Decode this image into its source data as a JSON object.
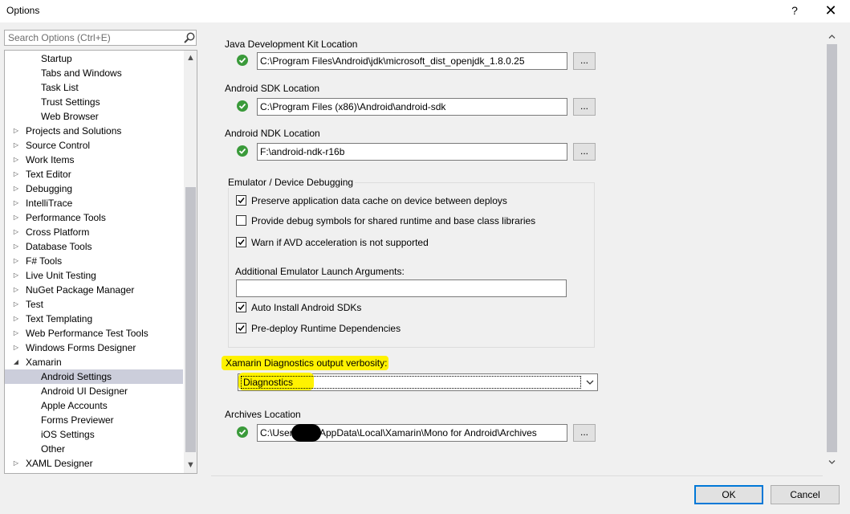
{
  "window": {
    "title": "Options",
    "help_glyph": "?",
    "close_glyph": "✕"
  },
  "search": {
    "placeholder": "Search Options (Ctrl+E)"
  },
  "tree": {
    "items": [
      {
        "label": "Startup",
        "level": 1,
        "expandable": false
      },
      {
        "label": "Tabs and Windows",
        "level": 1,
        "expandable": false
      },
      {
        "label": "Task List",
        "level": 1,
        "expandable": false
      },
      {
        "label": "Trust Settings",
        "level": 1,
        "expandable": false
      },
      {
        "label": "Web Browser",
        "level": 1,
        "expandable": false
      },
      {
        "label": "Projects and Solutions",
        "level": 0,
        "expandable": true
      },
      {
        "label": "Source Control",
        "level": 0,
        "expandable": true
      },
      {
        "label": "Work Items",
        "level": 0,
        "expandable": true
      },
      {
        "label": "Text Editor",
        "level": 0,
        "expandable": true
      },
      {
        "label": "Debugging",
        "level": 0,
        "expandable": true
      },
      {
        "label": "IntelliTrace",
        "level": 0,
        "expandable": true
      },
      {
        "label": "Performance Tools",
        "level": 0,
        "expandable": true
      },
      {
        "label": "Cross Platform",
        "level": 0,
        "expandable": true
      },
      {
        "label": "Database Tools",
        "level": 0,
        "expandable": true
      },
      {
        "label": "F# Tools",
        "level": 0,
        "expandable": true
      },
      {
        "label": "Live Unit Testing",
        "level": 0,
        "expandable": true
      },
      {
        "label": "NuGet Package Manager",
        "level": 0,
        "expandable": true
      },
      {
        "label": "Test",
        "level": 0,
        "expandable": true
      },
      {
        "label": "Text Templating",
        "level": 0,
        "expandable": true
      },
      {
        "label": "Web Performance Test Tools",
        "level": 0,
        "expandable": true
      },
      {
        "label": "Windows Forms Designer",
        "level": 0,
        "expandable": true
      },
      {
        "label": "Xamarin",
        "level": 0,
        "expandable": true,
        "expanded": true
      },
      {
        "label": "Android Settings",
        "level": 1,
        "expandable": false,
        "selected": true
      },
      {
        "label": "Android UI Designer",
        "level": 1,
        "expandable": false
      },
      {
        "label": "Apple Accounts",
        "level": 1,
        "expandable": false
      },
      {
        "label": "Forms Previewer",
        "level": 1,
        "expandable": false
      },
      {
        "label": "iOS Settings",
        "level": 1,
        "expandable": false
      },
      {
        "label": "Other",
        "level": 1,
        "expandable": false
      },
      {
        "label": "XAML Designer",
        "level": 0,
        "expandable": true
      }
    ]
  },
  "settings": {
    "jdk": {
      "label": "Java Development Kit Location",
      "value": "C:\\Program Files\\Android\\jdk\\microsoft_dist_openjdk_1.8.0.25",
      "browse": "..."
    },
    "sdk": {
      "label": "Android SDK Location",
      "value": "C:\\Program Files (x86)\\Android\\android-sdk",
      "browse": "..."
    },
    "ndk": {
      "label": "Android NDK Location",
      "value": "F:\\android-ndk-r16b",
      "browse": "..."
    },
    "emulator": {
      "title": "Emulator / Device Debugging",
      "preserve_cache": {
        "label": "Preserve application data cache on device between deploys",
        "checked": true
      },
      "debug_symbols": {
        "label": "Provide debug symbols for shared runtime and base class libraries",
        "checked": false
      },
      "warn_avd": {
        "label": "Warn if AVD acceleration is not supported",
        "checked": true
      },
      "args_label": "Additional Emulator Launch Arguments:",
      "args_value": "",
      "auto_install": {
        "label": "Auto Install Android SDKs",
        "checked": true
      },
      "predeploy": {
        "label": "Pre-deploy Runtime Dependencies",
        "checked": true
      }
    },
    "verbosity": {
      "label": "Xamarin Diagnostics output verbosity:",
      "value": "Diagnostics"
    },
    "archives": {
      "label": "Archives Location",
      "value_prefix": "C:\\User",
      "value_suffix": "AppData\\Local\\Xamarin\\Mono for Android\\Archives",
      "browse": "..."
    }
  },
  "buttons": {
    "ok": "OK",
    "cancel": "Cancel"
  },
  "colors": {
    "highlight": "#fff200",
    "status_ok": "#3a9a3a",
    "selection": "#cccedb",
    "ok_border": "#0078d7"
  }
}
